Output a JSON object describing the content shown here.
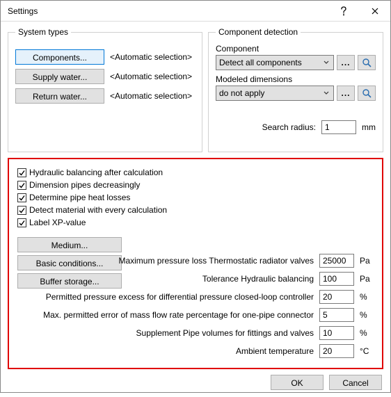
{
  "title": "Settings",
  "systemTypes": {
    "legend": "System types",
    "rows": [
      {
        "btn": "Components...",
        "label": "<Automatic selection>"
      },
      {
        "btn": "Supply water...",
        "label": "<Automatic selection>"
      },
      {
        "btn": "Return water...",
        "label": "<Automatic selection>"
      }
    ]
  },
  "componentDetection": {
    "legend": "Component detection",
    "componentLabel": "Component",
    "componentValue": "Detect all components",
    "modeledLabel": "Modeled dimensions",
    "modeledValue": "do not apply",
    "searchRadiusLabel": "Search radius:",
    "searchRadiusValue": "1",
    "searchRadiusUnit": "mm"
  },
  "options": {
    "cb1": "Hydraulic balancing after calculation",
    "cb2": "Dimension pipes decreasingly",
    "cb3": "Determine pipe heat losses",
    "cb4": "Detect material with every calculation",
    "cb5": "Label XP-value"
  },
  "buttons": {
    "medium": "Medium...",
    "basic": "Basic conditions...",
    "buffer": "Buffer storage..."
  },
  "params": [
    {
      "label": "Maximum pressure loss Thermostatic radiator valves",
      "value": "25000",
      "unit": "Pa"
    },
    {
      "label": "Tolerance Hydraulic balancing",
      "value": "100",
      "unit": "Pa"
    },
    {
      "label": "Permitted pressure excess for differential pressure closed-loop controller",
      "value": "20",
      "unit": "%"
    },
    {
      "label": "Max. permitted error of mass flow rate percentage for one-pipe connector",
      "value": "5",
      "unit": "%"
    },
    {
      "label": "Supplement Pipe volumes for fittings and valves",
      "value": "10",
      "unit": "%"
    },
    {
      "label": "Ambient temperature",
      "value": "20",
      "unit": "°C"
    }
  ],
  "dialog": {
    "ok": "OK",
    "cancel": "Cancel"
  }
}
